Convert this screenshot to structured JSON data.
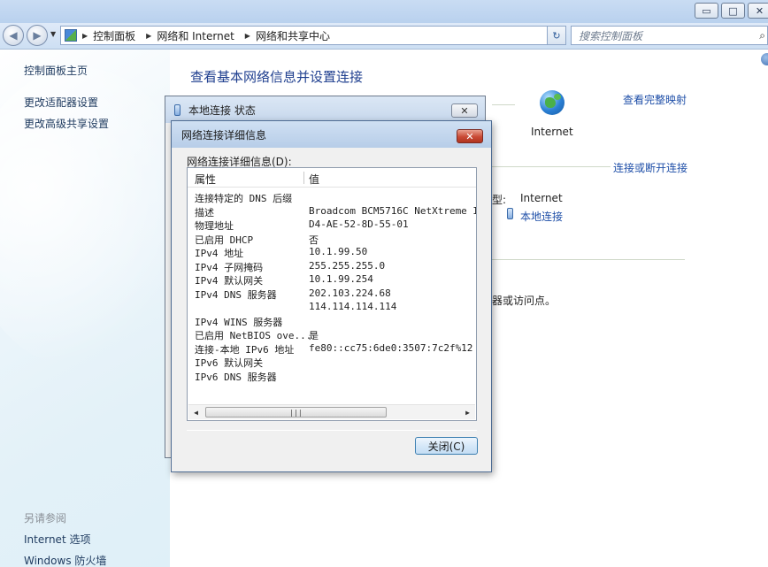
{
  "window": {
    "minimize_glyph": "▭",
    "maximize_glyph": "□",
    "close_glyph": "✕"
  },
  "address": {
    "breadcrumb": [
      "控制面板",
      "网络和 Internet",
      "网络和共享中心"
    ],
    "search_placeholder": "搜索控制面板"
  },
  "sidebar": {
    "items": [
      {
        "label": "控制面板主页"
      },
      {
        "label": "更改适配器设置"
      },
      {
        "label": "更改高级共享设置"
      }
    ],
    "see_also_label": "另请参阅",
    "see_also": [
      {
        "label": "Internet 选项"
      },
      {
        "label": "Windows 防火墙"
      }
    ]
  },
  "main": {
    "title": "查看基本网络信息并设置连接",
    "view_full_map": "查看完整映射",
    "internet_label": "Internet",
    "connect_disconnect": "连接或断开连接",
    "access_type_fragment": "型:",
    "access_type_value": "Internet",
    "connection_link": "本地连接",
    "access_point_fragment": "器或访问点。"
  },
  "status_dialog": {
    "title": "本地连接 状态"
  },
  "details_dialog": {
    "title": "网络连接详细信息",
    "label": "网络连接详细信息(D):",
    "columns": [
      "属性",
      "值"
    ],
    "rows": [
      {
        "k": "连接特定的 DNS 后缀",
        "v": ""
      },
      {
        "k": "描述",
        "v": "Broadcom BCM5716C NetXtreme II Gi"
      },
      {
        "k": "物理地址",
        "v": "D4-AE-52-8D-55-01"
      },
      {
        "k": "已启用 DHCP",
        "v": "否"
      },
      {
        "k": "IPv4 地址",
        "v": "10.1.99.50"
      },
      {
        "k": "IPv4 子网掩码",
        "v": "255.255.255.0"
      },
      {
        "k": "IPv4 默认网关",
        "v": "10.1.99.254"
      },
      {
        "k": "IPv4 DNS 服务器",
        "v": "202.103.224.68"
      },
      {
        "k": "",
        "v": "114.114.114.114"
      },
      {
        "k": "IPv4 WINS 服务器",
        "v": ""
      },
      {
        "k": "已启用 NetBIOS ove...",
        "v": "是"
      },
      {
        "k": "连接-本地 IPv6 地址",
        "v": "fe80::cc75:6de0:3507:7c2f%12"
      },
      {
        "k": "IPv6 默认网关",
        "v": ""
      },
      {
        "k": "IPv6 DNS 服务器",
        "v": ""
      }
    ],
    "close_button": "关闭(C)"
  },
  "colors": {
    "link": "#1f4fa8",
    "title": "#1f3f8f",
    "close_red": "#c94a35"
  }
}
